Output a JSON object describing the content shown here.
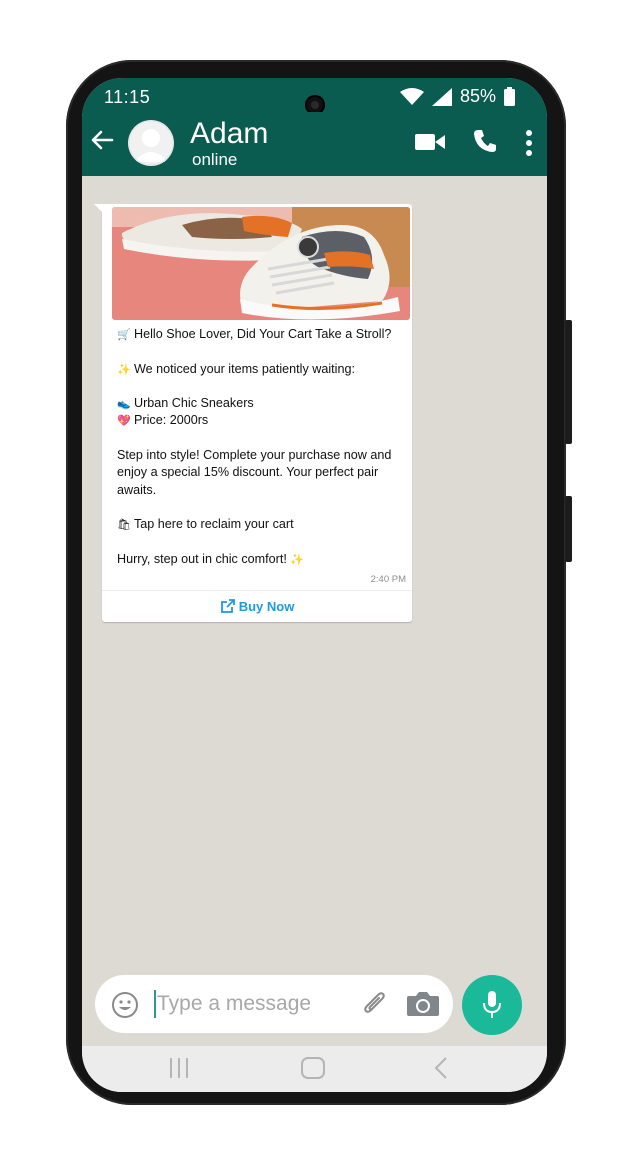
{
  "status_bar": {
    "time": "11:15",
    "battery": "85%"
  },
  "header": {
    "contact_name": "Adam",
    "contact_status": "online"
  },
  "message": {
    "lines": [
      "Hello Shoe Lover, Did Your Cart Take a Stroll?",
      "We noticed your items patiently waiting:",
      "Urban Chic Sneakers",
      "Price: 2000rs",
      "Step into style! Complete your purchase now and",
      "enjoy a special 15% discount. Your perfect pair",
      "awaits.",
      "Tap here to reclaim your cart",
      "Hurry, step out in chic comfort!"
    ],
    "time": "2:40 PM",
    "button_label": "Buy Now"
  },
  "input": {
    "placeholder": "Type a message"
  },
  "colors": {
    "header": "#0a5b50",
    "chat_bg": "#ddd9d3",
    "accent": "#1ab99a",
    "link": "#1d9ae3"
  },
  "icons": [
    "back-arrow-icon",
    "video-call-icon",
    "phone-icon",
    "more-vert-icon",
    "emoji-icon",
    "attach-icon",
    "camera-icon",
    "mic-icon"
  ]
}
